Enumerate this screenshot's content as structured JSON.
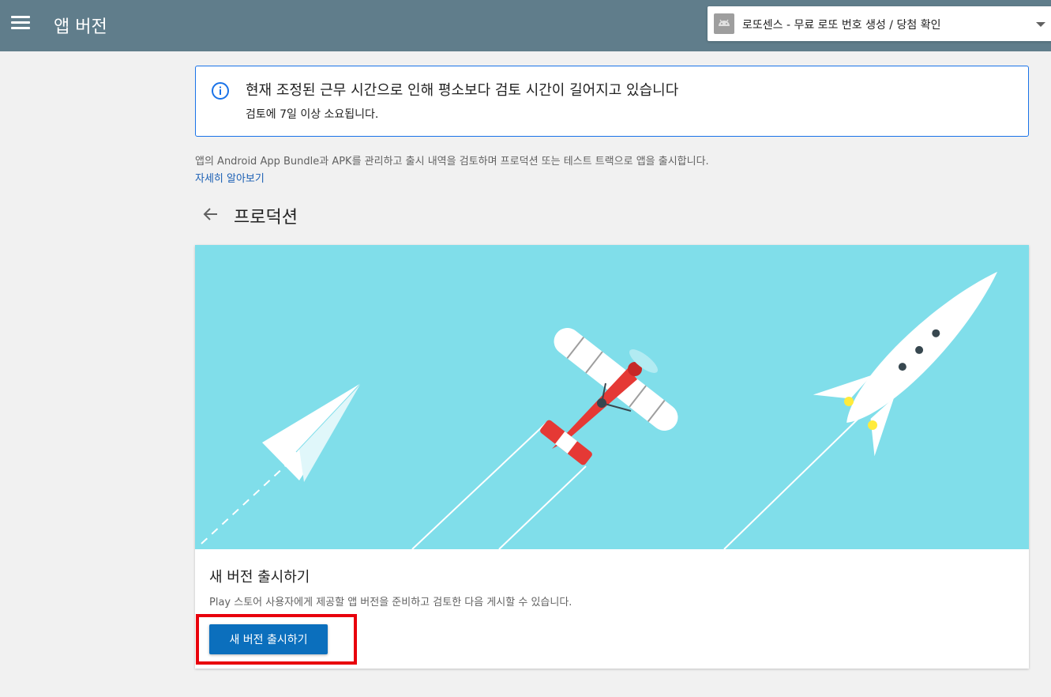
{
  "header": {
    "title": "앱 버전",
    "app_selector": {
      "value": "로또센스 - 무료 로또 번호 생성 / 당첨 확인"
    }
  },
  "notice": {
    "title": "현재 조정된 근무 시간으로 인해 평소보다 검토 시간이 길어지고 있습니다",
    "body": "검토에 7일 이상 소요됩니다."
  },
  "intro": {
    "description": "앱의 Android App Bundle과 APK를 관리하고 출시 내역을 검토하며 프로덕션 또는 테스트 트랙으로 앱을 출시합니다.",
    "learn_more": "자세히 알아보기"
  },
  "section": {
    "title": "프로덕션"
  },
  "release_card": {
    "title": "새 버전 출시하기",
    "description": "Play 스토어 사용자에게 제공할 앱 버전을 준비하고 검토한 다음 게시할 수 있습니다.",
    "button_label": "새 버전 출시하기"
  },
  "colors": {
    "topbar": "#607d8b",
    "hero_background": "#80deea",
    "primary_button": "#0b6fbd",
    "highlight": "#e8000c",
    "link": "#1a5fb4"
  }
}
